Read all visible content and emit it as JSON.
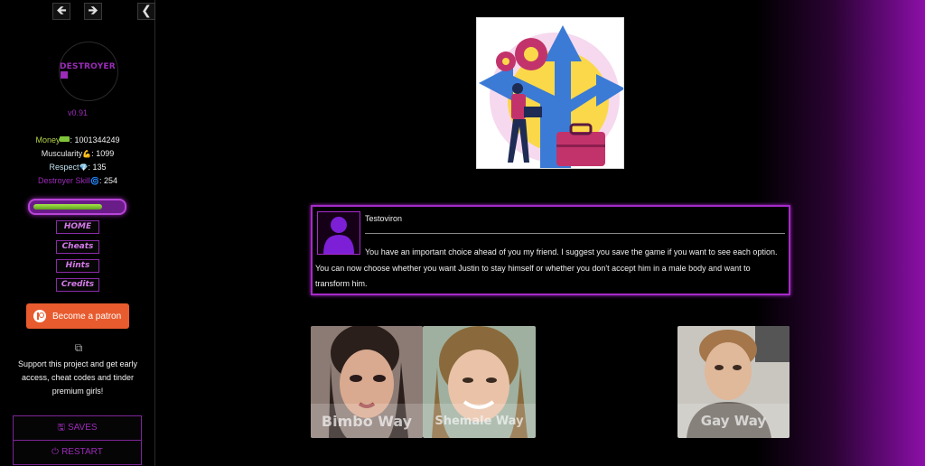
{
  "nav": {
    "back_glyph": "🡸",
    "forward_glyph": "🡺",
    "collapse_glyph": "❮"
  },
  "logo": {
    "text": "DESTROYER"
  },
  "version": "v0.91",
  "stats": {
    "money_label": "Money",
    "money_value": "1001344249",
    "muscularity_label": "Muscularity",
    "muscularity_value": "1099",
    "respect_label": "Respect",
    "respect_value": "135",
    "skill_label": "Destroyer Skill",
    "skill_value": "254"
  },
  "progress": {
    "fraction": 0.78,
    "color": "#7fc43a"
  },
  "menu": [
    "HOME",
    "Cheats",
    "Hints",
    "Credits"
  ],
  "patron": {
    "label": "Become a patron",
    "color": "#e85b2e"
  },
  "support_text": "Support this project and get early access, cheat codes and tinder premium girls!",
  "bottom_buttons": {
    "saves": "SAVES",
    "restart": "RESTART"
  },
  "icons": {
    "back": "arrow-left-icon",
    "forward": "arrow-right-icon",
    "collapse": "chevron-left-icon",
    "money": "money-icon",
    "muscle": "muscle-icon",
    "respect": "diamond-icon",
    "skill": "skill-icon",
    "patreon": "patreon-icon",
    "external": "external-link-icon",
    "saves": "floppy-icon",
    "restart": "power-icon"
  },
  "dialog": {
    "speaker": "Testoviron",
    "text": "You have an important choice ahead of you my friend. I suggest you save the game if you want to see each option. You can now choose whether you want Justin to stay himself or whether you don't accept him in a male body and want to transform him."
  },
  "choices": [
    "Bimbo Way",
    "Shemale Way",
    "Gay Way"
  ],
  "colors": {
    "accent": "#a62ac9",
    "sidebar_text": "#9b2bb8",
    "background": "#000000"
  }
}
